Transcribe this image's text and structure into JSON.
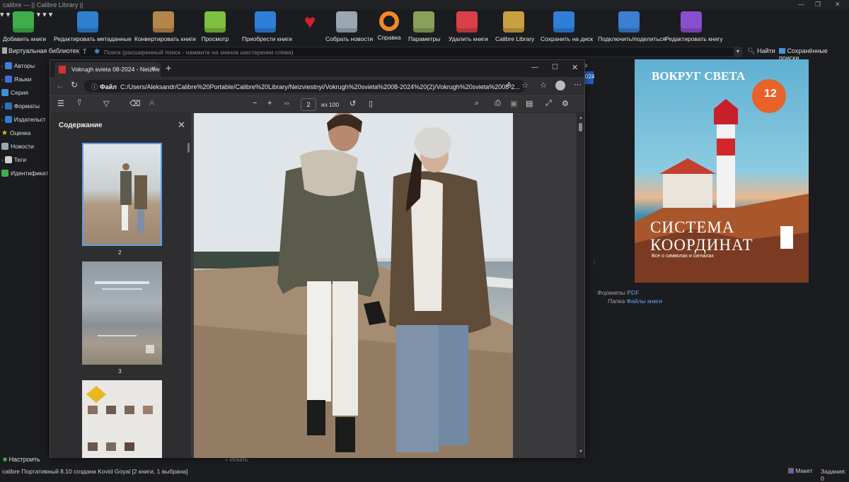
{
  "window": {
    "title": "calibre — || Calibre Library ||"
  },
  "toolbar": {
    "items": [
      {
        "label": "Добавить книги",
        "icon": "add-book-icon",
        "color": "#3fae4a"
      },
      {
        "label": "Редактировать метаданные",
        "icon": "edit-metadata-icon",
        "color": "#2f7fcf"
      },
      {
        "label": "Конвертировать книги",
        "icon": "convert-book-icon",
        "color": "#b4864a"
      },
      {
        "label": "Просмотр",
        "icon": "view-book-icon",
        "color": "#7fbf3f"
      },
      {
        "label": "Приобрести книги",
        "icon": "get-books-icon",
        "color": "#2f7fd8"
      },
      {
        "label": "",
        "icon": "donate-heart-icon",
        "color": "#d0202a"
      },
      {
        "label": "Собрать новости",
        "icon": "fetch-news-icon",
        "color": "#9aa6b2"
      },
      {
        "label": "Справка",
        "icon": "help-lifebuoy-icon",
        "color": "#f08a24"
      },
      {
        "label": "Параметры",
        "icon": "preferences-tools-icon",
        "color": "#8aa05a"
      },
      {
        "label": "Удалить книги",
        "icon": "remove-book-icon",
        "color": "#d9404a"
      },
      {
        "label": "Calibre Library",
        "icon": "library-books-icon",
        "color": "#c8a040"
      },
      {
        "label": "Сохранить на диск",
        "icon": "save-to-disk-icon",
        "color": "#2f7fd8"
      },
      {
        "label": "Подключить/поделиться",
        "icon": "connect-share-icon",
        "color": "#3a7fd0"
      },
      {
        "label": "Редактировать книгу",
        "icon": "edit-book-icon",
        "color": "#8a4fd0"
      }
    ]
  },
  "search": {
    "virtual_library": "Виртуальная библиотека",
    "placeholder": "Поиск (расширенный поиск - нажмите на значок шестеренки слева)",
    "find": "Найти",
    "saved_searches": "Сохранённые поиски"
  },
  "tag_browser": {
    "items": [
      {
        "label": "Авторы",
        "icon": "authors-icon",
        "color": "#3f7fd8"
      },
      {
        "label": "Языки",
        "icon": "languages-icon",
        "color": "#3f6fd0"
      },
      {
        "label": "Серия",
        "icon": "series-icon",
        "color": "#3f8fd8"
      },
      {
        "label": "Форматы",
        "icon": "formats-icon",
        "color": "#2f6fc0"
      },
      {
        "label": "Издательст",
        "icon": "publisher-icon",
        "color": "#2f7fcf"
      },
      {
        "label": "Оценка",
        "icon": "rating-star-icon",
        "color": "#f0c020"
      },
      {
        "label": "Новости",
        "icon": "news-icon",
        "color": "#9aa6b2"
      },
      {
        "label": "Теги",
        "icon": "tags-icon",
        "color": "#d0d0d0"
      },
      {
        "label": "Идентификат",
        "icon": "identifiers-icon",
        "color": "#3fae4a"
      }
    ],
    "configure": "Настроить",
    "find_placeholder": "Искать"
  },
  "book_details": {
    "formats_key": "Форматы",
    "formats_value": "PDF",
    "folder_key": "Папка",
    "folder_value": "Файлы книги",
    "cover": {
      "masthead": "ВОКРУГ СВЕТА",
      "badge_number": "12",
      "headline_1": "СИСТЕМА",
      "headline_2": "КООРДИНАТ",
      "tagline": "Все о символах и сигналах"
    }
  },
  "library_peek": {
    "header_fragment": "ков",
    "year_fragment": "024"
  },
  "browser": {
    "tab_title": "Vokrugh svieta 08-2024 - Neizvie",
    "file_label": "Файл",
    "url": "C:/Users/Aleksandr/Calibre%20Portable/Calibre%20Library/Neizviestnyi/Vokrugh%20svieta%2008-2024%20(2)/Vokrugh%20svieta%2008-2...",
    "page_current": "2",
    "page_of": "из 100",
    "sidebar_title": "Содержание",
    "thumbnails": [
      {
        "label": "2"
      },
      {
        "label": "3"
      }
    ]
  },
  "status": {
    "left": "calibre Портативный 8.10 создана Kovid Goyal  [2 книги, 1 выбрана]",
    "layout": "Макет",
    "jobs": "Задания: 0"
  }
}
